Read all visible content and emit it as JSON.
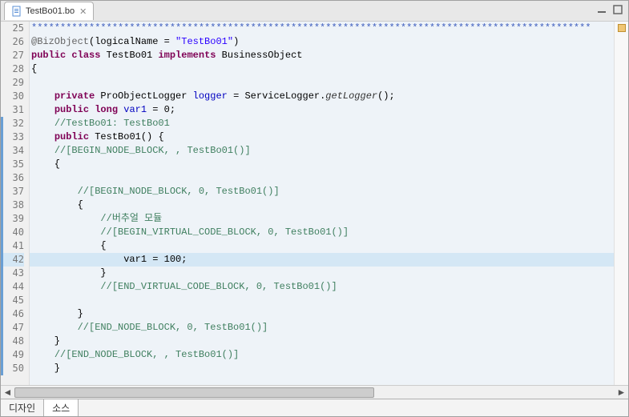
{
  "tab": {
    "filename": "TestBo01.bo"
  },
  "lines": [
    {
      "num": 25,
      "marked": false,
      "hl": false,
      "segs": [
        {
          "t": "*************************************************************************************************",
          "c": "stars"
        }
      ]
    },
    {
      "num": 26,
      "marked": false,
      "hl": false,
      "segs": [
        {
          "t": "@BizObject",
          "c": "anno"
        },
        {
          "t": "(logicalName = ",
          "c": "type"
        },
        {
          "t": "\"TestBo01\"",
          "c": "str"
        },
        {
          "t": ")",
          "c": "type"
        }
      ]
    },
    {
      "num": 27,
      "marked": false,
      "hl": false,
      "segs": [
        {
          "t": "public",
          "c": "kw"
        },
        {
          "t": " ",
          "c": "type"
        },
        {
          "t": "class",
          "c": "kw"
        },
        {
          "t": " TestBo01 ",
          "c": "type"
        },
        {
          "t": "implements",
          "c": "kw"
        },
        {
          "t": " BusinessObject",
          "c": "type"
        }
      ]
    },
    {
      "num": 28,
      "marked": false,
      "hl": false,
      "segs": [
        {
          "t": "{",
          "c": "type"
        }
      ]
    },
    {
      "num": 29,
      "marked": false,
      "hl": false,
      "segs": [
        {
          "t": "",
          "c": "type"
        }
      ]
    },
    {
      "num": 30,
      "marked": false,
      "hl": false,
      "segs": [
        {
          "t": "    ",
          "c": "type"
        },
        {
          "t": "private",
          "c": "kw"
        },
        {
          "t": " ProObjectLogger ",
          "c": "type"
        },
        {
          "t": "logger",
          "c": "field"
        },
        {
          "t": " = ServiceLogger.",
          "c": "type"
        },
        {
          "t": "getLogger",
          "c": "meth"
        },
        {
          "t": "();",
          "c": "type"
        }
      ]
    },
    {
      "num": 31,
      "marked": false,
      "hl": false,
      "segs": [
        {
          "t": "    ",
          "c": "type"
        },
        {
          "t": "public",
          "c": "kw"
        },
        {
          "t": " ",
          "c": "type"
        },
        {
          "t": "long",
          "c": "kw"
        },
        {
          "t": " ",
          "c": "type"
        },
        {
          "t": "var1",
          "c": "field"
        },
        {
          "t": " = 0;",
          "c": "type"
        }
      ]
    },
    {
      "num": 32,
      "marked": true,
      "hl": false,
      "segs": [
        {
          "t": "    ",
          "c": "type"
        },
        {
          "t": "//TestBo01: TestBo01",
          "c": "cmt"
        }
      ]
    },
    {
      "num": 33,
      "marked": true,
      "hl": false,
      "segs": [
        {
          "t": "    ",
          "c": "type"
        },
        {
          "t": "public",
          "c": "kw"
        },
        {
          "t": " TestBo01() {",
          "c": "type"
        }
      ]
    },
    {
      "num": 34,
      "marked": true,
      "hl": false,
      "segs": [
        {
          "t": "    ",
          "c": "type"
        },
        {
          "t": "//[BEGIN_NODE_BLOCK, , TestBo01()]",
          "c": "cmt"
        }
      ]
    },
    {
      "num": 35,
      "marked": true,
      "hl": false,
      "segs": [
        {
          "t": "    {",
          "c": "type"
        }
      ]
    },
    {
      "num": 36,
      "marked": true,
      "hl": false,
      "segs": [
        {
          "t": "",
          "c": "type"
        }
      ]
    },
    {
      "num": 37,
      "marked": true,
      "hl": false,
      "segs": [
        {
          "t": "        ",
          "c": "type"
        },
        {
          "t": "//[BEGIN_NODE_BLOCK, 0, TestBo01()]",
          "c": "cmt"
        }
      ]
    },
    {
      "num": 38,
      "marked": true,
      "hl": false,
      "segs": [
        {
          "t": "        {",
          "c": "type"
        }
      ]
    },
    {
      "num": 39,
      "marked": true,
      "hl": false,
      "segs": [
        {
          "t": "            ",
          "c": "type"
        },
        {
          "t": "//버추얼 모듈",
          "c": "cmt"
        }
      ]
    },
    {
      "num": 40,
      "marked": true,
      "hl": false,
      "segs": [
        {
          "t": "            ",
          "c": "type"
        },
        {
          "t": "//[BEGIN_VIRTUAL_CODE_BLOCK, 0, TestBo01()]",
          "c": "cmt"
        }
      ]
    },
    {
      "num": 41,
      "marked": true,
      "hl": false,
      "segs": [
        {
          "t": "            {",
          "c": "type"
        }
      ]
    },
    {
      "num": 42,
      "marked": true,
      "hl": true,
      "segs": [
        {
          "t": "                var1 = 100;",
          "c": "type"
        }
      ]
    },
    {
      "num": 43,
      "marked": true,
      "hl": false,
      "segs": [
        {
          "t": "            }",
          "c": "type"
        }
      ]
    },
    {
      "num": 44,
      "marked": true,
      "hl": false,
      "segs": [
        {
          "t": "            ",
          "c": "type"
        },
        {
          "t": "//[END_VIRTUAL_CODE_BLOCK, 0, TestBo01()]",
          "c": "cmt"
        }
      ]
    },
    {
      "num": 45,
      "marked": true,
      "hl": false,
      "segs": [
        {
          "t": "",
          "c": "type"
        }
      ]
    },
    {
      "num": 46,
      "marked": true,
      "hl": false,
      "segs": [
        {
          "t": "        }",
          "c": "type"
        }
      ]
    },
    {
      "num": 47,
      "marked": true,
      "hl": false,
      "segs": [
        {
          "t": "        ",
          "c": "type"
        },
        {
          "t": "//[END_NODE_BLOCK, 0, TestBo01()]",
          "c": "cmt"
        }
      ]
    },
    {
      "num": 48,
      "marked": true,
      "hl": false,
      "segs": [
        {
          "t": "    }",
          "c": "type"
        }
      ]
    },
    {
      "num": 49,
      "marked": true,
      "hl": false,
      "segs": [
        {
          "t": "    ",
          "c": "type"
        },
        {
          "t": "//[END_NODE_BLOCK, , TestBo01()]",
          "c": "cmt"
        }
      ]
    },
    {
      "num": 50,
      "marked": true,
      "hl": false,
      "segs": [
        {
          "t": "    }",
          "c": "type"
        }
      ]
    }
  ],
  "bottomTabs": {
    "design": "디자인",
    "source": "소스"
  }
}
